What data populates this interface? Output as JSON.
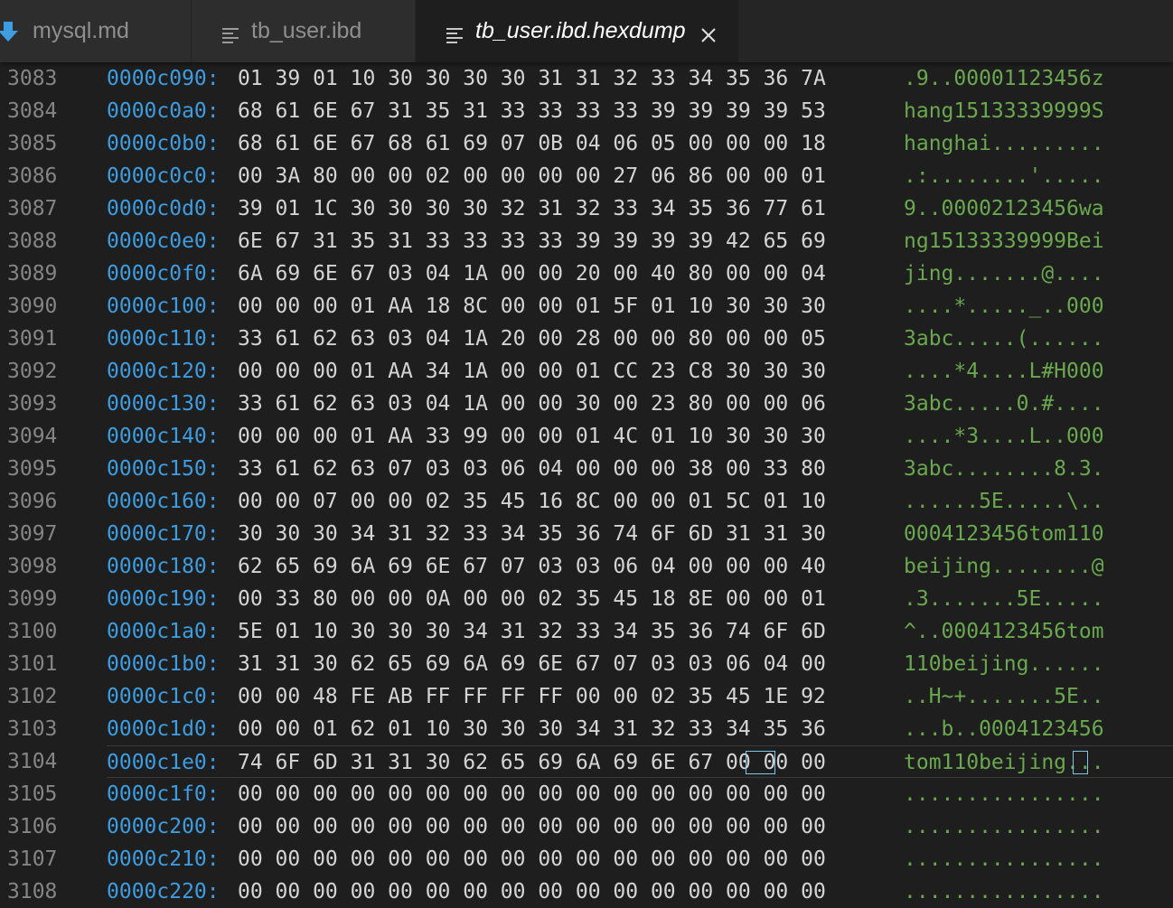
{
  "tabs": [
    {
      "label": "mysql.md",
      "icon": "markdown-arrow-icon",
      "active": false
    },
    {
      "label": "tb_user.ibd",
      "icon": "lines-icon",
      "active": false
    },
    {
      "label": "tb_user.ibd.hexdump",
      "icon": "lines-icon",
      "active": true,
      "close": "×"
    }
  ],
  "colors": {
    "address": "#3e9ce0",
    "ascii": "#6aa84f",
    "line_number": "#858585",
    "hex": "#d4d4d4",
    "markdown_icon": "#3e9ce0"
  },
  "current_line": 3104,
  "lines": [
    {
      "n": "3083",
      "addr": "0000c090:",
      "hex": "01 39 01 10 30 30 30 30 31 31 32 33 34 35 36 7A",
      "ascii": ".9..00001123456z"
    },
    {
      "n": "3084",
      "addr": "0000c0a0:",
      "hex": "68 61 6E 67 31 35 31 33 33 33 33 39 39 39 39 53",
      "ascii": "hang15133339999S"
    },
    {
      "n": "3085",
      "addr": "0000c0b0:",
      "hex": "68 61 6E 67 68 61 69 07 0B 04 06 05 00 00 00 18",
      "ascii": "hanghai........."
    },
    {
      "n": "3086",
      "addr": "0000c0c0:",
      "hex": "00 3A 80 00 00 02 00 00 00 00 27 06 86 00 00 01",
      "ascii": ".:........'....."
    },
    {
      "n": "3087",
      "addr": "0000c0d0:",
      "hex": "39 01 1C 30 30 30 30 32 31 32 33 34 35 36 77 61",
      "ascii": "9..00002123456wa"
    },
    {
      "n": "3088",
      "addr": "0000c0e0:",
      "hex": "6E 67 31 35 31 33 33 33 33 39 39 39 39 42 65 69",
      "ascii": "ng15133339999Bei"
    },
    {
      "n": "3089",
      "addr": "0000c0f0:",
      "hex": "6A 69 6E 67 03 04 1A 00 00 20 00 40 80 00 00 04",
      "ascii": "jing.......@...."
    },
    {
      "n": "3090",
      "addr": "0000c100:",
      "hex": "00 00 00 01 AA 18 8C 00 00 01 5F 01 10 30 30 30",
      "ascii": "....*....._..000"
    },
    {
      "n": "3091",
      "addr": "0000c110:",
      "hex": "33 61 62 63 03 04 1A 20 00 28 00 00 80 00 00 05",
      "ascii": "3abc.....(......"
    },
    {
      "n": "3092",
      "addr": "0000c120:",
      "hex": "00 00 00 01 AA 34 1A 00 00 01 CC 23 C8 30 30 30",
      "ascii": "....*4....L#H000"
    },
    {
      "n": "3093",
      "addr": "0000c130:",
      "hex": "33 61 62 63 03 04 1A 00 00 30 00 23 80 00 00 06",
      "ascii": "3abc.....0.#...."
    },
    {
      "n": "3094",
      "addr": "0000c140:",
      "hex": "00 00 00 01 AA 33 99 00 00 01 4C 01 10 30 30 30",
      "ascii": "....*3....L..000"
    },
    {
      "n": "3095",
      "addr": "0000c150:",
      "hex": "33 61 62 63 07 03 03 06 04 00 00 00 38 00 33 80",
      "ascii": "3abc........8.3."
    },
    {
      "n": "3096",
      "addr": "0000c160:",
      "hex": "00 00 07 00 00 02 35 45 16 8C 00 00 01 5C 01 10",
      "ascii": "......5E.....\\.."
    },
    {
      "n": "3097",
      "addr": "0000c170:",
      "hex": "30 30 30 34 31 32 33 34 35 36 74 6F 6D 31 31 30",
      "ascii": "0004123456tom110"
    },
    {
      "n": "3098",
      "addr": "0000c180:",
      "hex": "62 65 69 6A 69 6E 67 07 03 03 06 04 00 00 00 40",
      "ascii": "beijing........@"
    },
    {
      "n": "3099",
      "addr": "0000c190:",
      "hex": "00 33 80 00 00 0A 00 00 02 35 45 18 8E 00 00 01",
      "ascii": ".3.......5E....."
    },
    {
      "n": "3100",
      "addr": "0000c1a0:",
      "hex": "5E 01 10 30 30 30 34 31 32 33 34 35 36 74 6F 6D",
      "ascii": "^..0004123456tom"
    },
    {
      "n": "3101",
      "addr": "0000c1b0:",
      "hex": "31 31 30 62 65 69 6A 69 6E 67 07 03 03 06 04 00",
      "ascii": "110beijing......"
    },
    {
      "n": "3102",
      "addr": "0000c1c0:",
      "hex": "00 00 48 FE AB FF FF FF FF 00 00 02 35 45 1E 92",
      "ascii": "..H~+.......5E.."
    },
    {
      "n": "3103",
      "addr": "0000c1d0:",
      "hex": "00 00 01 62 01 10 30 30 30 34 31 32 33 34 35 36",
      "ascii": "...b..0004123456"
    },
    {
      "n": "3104",
      "addr": "0000c1e0:",
      "hex": "74 6F 6D 31 31 30 62 65 69 6A 69 6E 67 00 00 00",
      "ascii": "tom110beijing..."
    },
    {
      "n": "3105",
      "addr": "0000c1f0:",
      "hex": "00 00 00 00 00 00 00 00 00 00 00 00 00 00 00 00",
      "ascii": "................"
    },
    {
      "n": "3106",
      "addr": "0000c200:",
      "hex": "00 00 00 00 00 00 00 00 00 00 00 00 00 00 00 00",
      "ascii": "................"
    },
    {
      "n": "3107",
      "addr": "0000c210:",
      "hex": "00 00 00 00 00 00 00 00 00 00 00 00 00 00 00 00",
      "ascii": "................"
    },
    {
      "n": "3108",
      "addr": "0000c220:",
      "hex": "00 00 00 00 00 00 00 00 00 00 00 00 00 00 00 00",
      "ascii": "................"
    }
  ]
}
